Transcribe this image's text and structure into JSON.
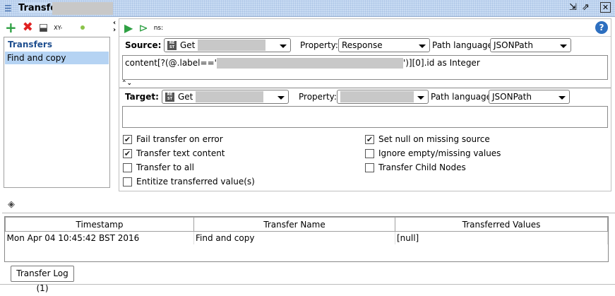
{
  "window": {
    "title": "Transfer"
  },
  "left": {
    "toolbar": {
      "xy_label": "XY-"
    },
    "header": "Transfers",
    "items": [
      "Find and copy"
    ]
  },
  "toolbar": {
    "ns_label": "ns:"
  },
  "source": {
    "label": "Source:",
    "step": "Get",
    "property_label": "Property:",
    "property": "Response",
    "path_language_label": "Path language:",
    "path_language": "JSONPath",
    "expression_prefix": "content[?(@.label=='",
    "expression_suffix": "')][0].id as Integer"
  },
  "target": {
    "label": "Target:",
    "step": "Get",
    "property_label": "Property:",
    "property": "",
    "path_language_label": "Path language:",
    "path_language": "JSONPath",
    "expression": ""
  },
  "options": {
    "left": [
      {
        "label": "Fail transfer on error",
        "checked": true
      },
      {
        "label": "Transfer text content",
        "checked": true
      },
      {
        "label": "Transfer to all",
        "checked": false
      },
      {
        "label": "Entitize transferred value(s)",
        "checked": false
      }
    ],
    "right": [
      {
        "label": "Set null on missing source",
        "checked": true
      },
      {
        "label": "Ignore empty/missing values",
        "checked": false
      },
      {
        "label": "Transfer Child Nodes",
        "checked": false
      }
    ]
  },
  "log": {
    "columns": [
      "Timestamp",
      "Transfer Name",
      "Transferred Values"
    ],
    "rows": [
      [
        "Mon Apr 04 10:45:42 BST 2016",
        "Find and copy",
        "[null]"
      ]
    ],
    "tab_label": "Transfer Log (1)"
  }
}
